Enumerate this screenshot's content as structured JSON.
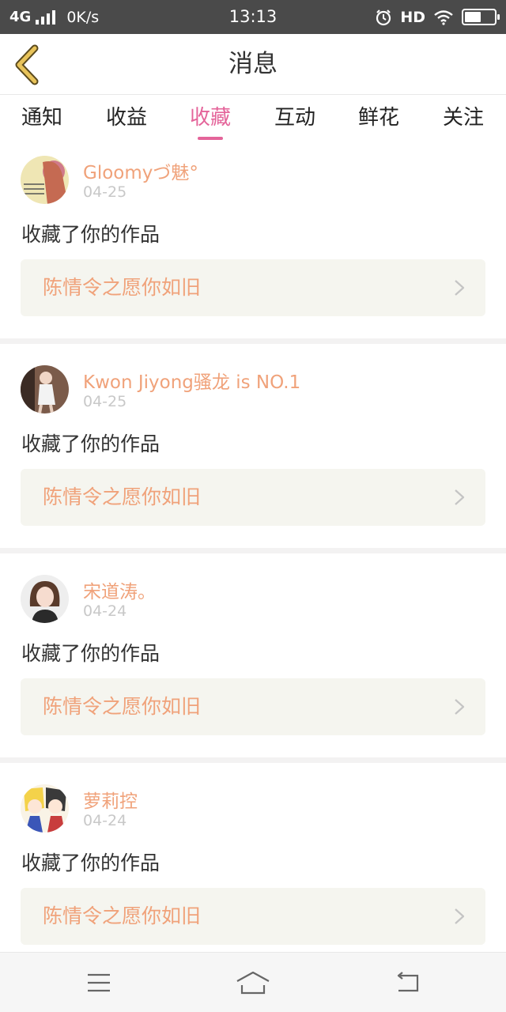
{
  "status_bar": {
    "network": "4G",
    "speed": "0K/s",
    "time": "13:13",
    "hd": "HD",
    "battery_level": 0.55
  },
  "header": {
    "title": "消息",
    "back_icon": "chevron-left-icon"
  },
  "tabs": [
    {
      "label": "通知",
      "active": false
    },
    {
      "label": "收益",
      "active": false
    },
    {
      "label": "收藏",
      "active": true
    },
    {
      "label": "互动",
      "active": false
    },
    {
      "label": "鲜花",
      "active": false
    },
    {
      "label": "关注",
      "active": false
    }
  ],
  "messages": [
    {
      "user": "Gloomyづ魅°",
      "date": "04-25",
      "action": "收藏了你的作品",
      "work_title": "陈情令之愿你如旧"
    },
    {
      "user": "Kwon Jiyong骚龙 is NO.1",
      "date": "04-25",
      "action": "收藏了你的作品",
      "work_title": "陈情令之愿你如旧"
    },
    {
      "user": "宋道涛。",
      "date": "04-24",
      "action": "收藏了你的作品",
      "work_title": "陈情令之愿你如旧"
    },
    {
      "user": "萝莉控",
      "date": "04-24",
      "action": "收藏了你的作品",
      "work_title": "陈情令之愿你如旧"
    }
  ],
  "colors": {
    "accent": "#e4649a",
    "username": "#f0a27a",
    "back_icon": "#e8c35a"
  },
  "nav_bar": {
    "icons": [
      "menu-icon",
      "home-icon",
      "back-icon"
    ]
  }
}
